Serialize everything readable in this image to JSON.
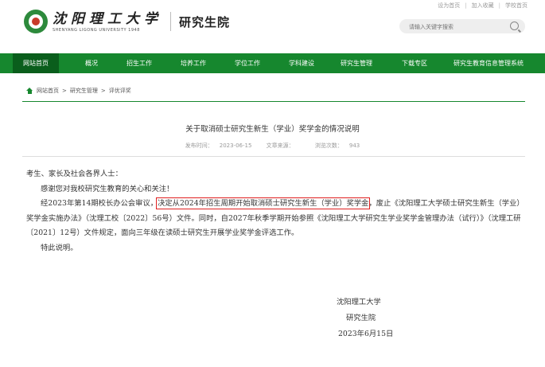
{
  "header": {
    "toplinks": [
      "设为首页",
      "加入收藏",
      "学校首页"
    ],
    "logo_cn": "沈阳理工大学",
    "logo_en": "SHENYANG LIGONG UNIVERSITY 1948",
    "site_name": "研究生院",
    "search_placeholder": "请输入关键字搜索"
  },
  "nav": {
    "items": [
      "网站首页",
      "概况",
      "招生工作",
      "培养工作",
      "学位工作",
      "学科建设",
      "研究生管理",
      "下载专区",
      "研究生教育信息管理系统"
    ]
  },
  "breadcrumb": {
    "items": [
      "网站首页",
      "研究生管理",
      "评优评奖"
    ]
  },
  "article": {
    "title": "关于取消硕士研究生新生（学业）奖学金的情况说明",
    "meta": {
      "date_label": "发布时间：",
      "date": "2023-06-15",
      "source_label": "文章来源：",
      "source": "",
      "views_label": "浏览次数：",
      "views": "943"
    },
    "greeting": "考生、家长及社会各界人士：",
    "thanks": "感谢您对我校研究生教育的关心和关注！",
    "para_start": "经2023年第14期校长办公会审议，",
    "para_highlight": "决定从2024年招生周期开始取消硕士研究生新生（学业）奖学金",
    "para_rest": "，废止《沈阳理工大学硕士研究生新生（学业）奖学金实施办法》（沈理工校〔2022〕56号）文件。同时，自2027年秋季学期开始参照《沈阳理工大学研究生学业奖学金管理办法（试行）》（沈理工研〔2021〕12号）文件规定，面向三年级在读硕士研究生开展学业奖学金评选工作。",
    "closing": "特此说明。",
    "signature": [
      "沈阳理工大学",
      "研究生院",
      "2023年6月15日"
    ]
  }
}
